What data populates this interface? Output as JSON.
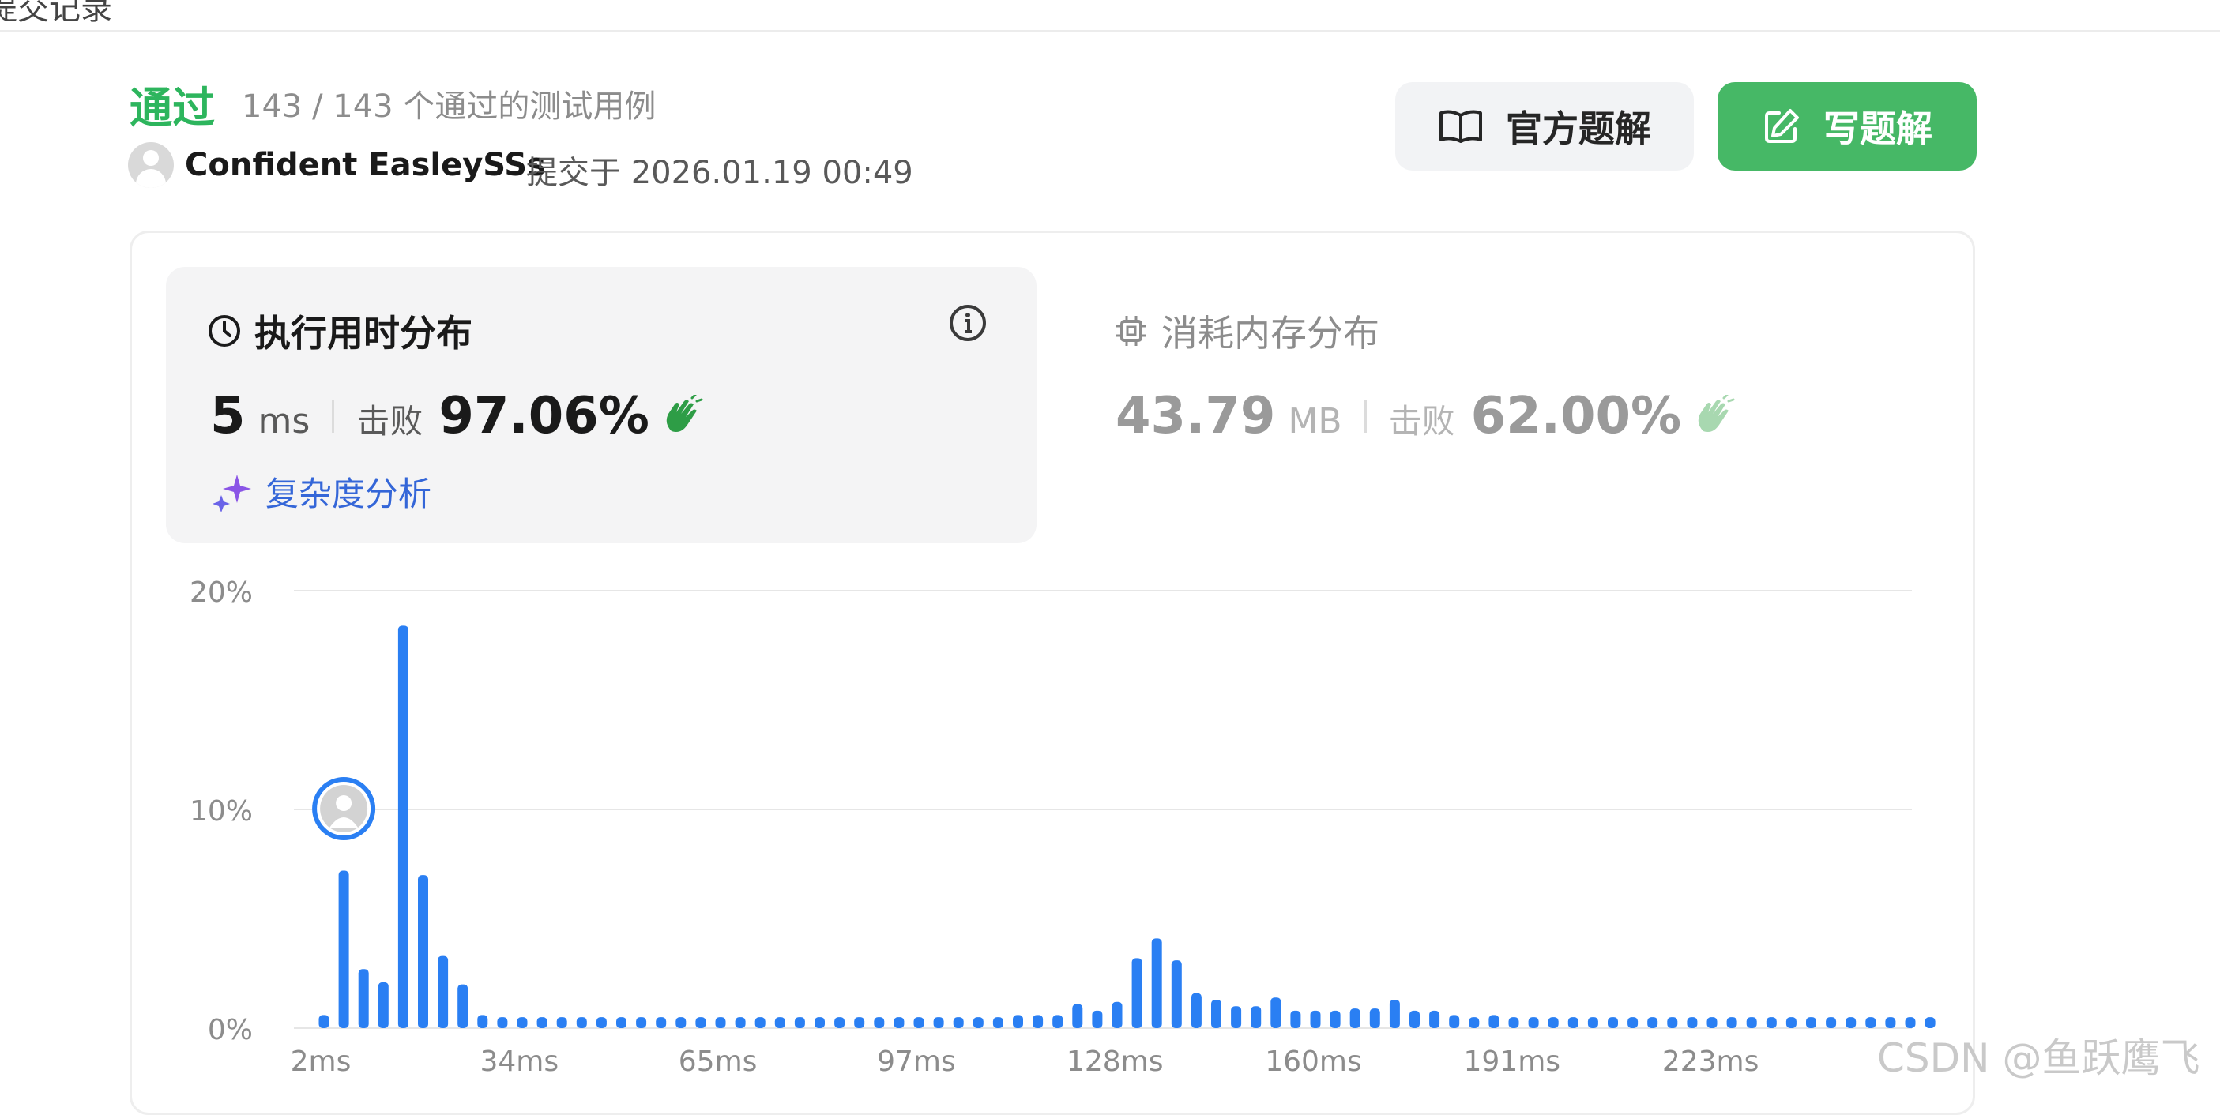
{
  "page": {
    "breadcrumb_fragment": "提交记录",
    "status": "通过",
    "passed_count": "143 / 143 个通过的测试用例",
    "username": "Confident EasleySSs",
    "submitted_at": "提交于 2026.01.19 00:49",
    "buttons": {
      "official_solution": "官方题解",
      "write_solution": "写题解"
    }
  },
  "runtime": {
    "title": "执行用时分布",
    "value": "5",
    "unit": "ms",
    "beat_label": "击败",
    "beat_percent": "97.06%",
    "complexity_link": "复杂度分析"
  },
  "memory": {
    "title": "消耗内存分布",
    "value": "43.79",
    "unit": "MB",
    "beat_label": "击败",
    "beat_percent": "62.00%"
  },
  "colors": {
    "accent_green": "#2db55d",
    "bar_blue": "#2a7ff3",
    "link_blue": "#3466d8",
    "sparkle_purple": "#8a55e6"
  },
  "icons": [
    "book-icon",
    "edit-icon",
    "clock-icon",
    "info-icon",
    "chip-icon",
    "sparkle-icon",
    "clap-icon",
    "avatar-icon"
  ],
  "watermark": "CSDN @鱼跃鹰飞",
  "chart_data": {
    "type": "bar",
    "title": "",
    "xlabel": "",
    "ylabel": "",
    "ylim": [
      0,
      20
    ],
    "ytick_labels": [
      "0%",
      "10%",
      "20%"
    ],
    "xtick_labels": [
      "2ms",
      "34ms",
      "65ms",
      "97ms",
      "128ms",
      "160ms",
      "191ms",
      "223ms"
    ],
    "grid": true,
    "user_marker_bar_index": 1,
    "values": [
      0.6,
      7.2,
      2.7,
      2.1,
      18.4,
      7.0,
      3.3,
      2.0,
      0.6,
      0.5,
      0.5,
      0.5,
      0.5,
      0.5,
      0.5,
      0.5,
      0.5,
      0.5,
      0.5,
      0.5,
      0.5,
      0.5,
      0.5,
      0.5,
      0.5,
      0.5,
      0.5,
      0.5,
      0.5,
      0.5,
      0.5,
      0.5,
      0.5,
      0.5,
      0.5,
      0.6,
      0.6,
      0.6,
      1.1,
      0.8,
      1.2,
      3.2,
      4.1,
      3.1,
      1.6,
      1.3,
      1.0,
      1.0,
      1.4,
      0.8,
      0.8,
      0.8,
      0.9,
      0.9,
      1.3,
      0.8,
      0.8,
      0.6,
      0.5,
      0.6,
      0.5,
      0.5,
      0.5,
      0.5,
      0.5,
      0.5,
      0.5,
      0.5,
      0.5,
      0.5,
      0.5,
      0.5,
      0.5,
      0.5,
      0.5,
      0.5,
      0.5,
      0.5,
      0.5,
      0.5,
      0.5,
      0.5
    ]
  }
}
